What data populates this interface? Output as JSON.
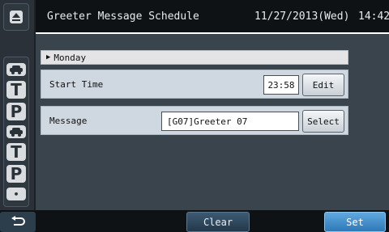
{
  "header": {
    "title": "Greeter Message Schedule",
    "date": "11/27/2013(Wed)",
    "time": "14:42"
  },
  "sidebar": {
    "icons": [
      {
        "name": "eject-icon",
        "glyph": "⏏"
      },
      {
        "name": "car-icon",
        "glyph": "🚗"
      },
      {
        "name": "t-icon",
        "glyph": "T"
      },
      {
        "name": "p-icon",
        "glyph": "P"
      },
      {
        "name": "car-icon",
        "glyph": "🚗"
      },
      {
        "name": "t-icon",
        "glyph": "T"
      },
      {
        "name": "p-icon",
        "glyph": "P"
      },
      {
        "name": "dot-icon",
        "glyph": "•"
      }
    ]
  },
  "schedule": {
    "day": "Monday",
    "start_time_label": "Start Time",
    "start_time_value": "23:58",
    "edit_label": "Edit",
    "message_label": "Message",
    "message_value": "[G07]Greeter 07",
    "select_label": "Select"
  },
  "footer": {
    "back_icon": "return-arrow-icon",
    "clear_label": "Clear",
    "set_label": "Set"
  },
  "colors": {
    "background": "#3c4650",
    "header": "#0f1215",
    "row": "#cfd7e0",
    "set_button": "#3f8ccb"
  }
}
